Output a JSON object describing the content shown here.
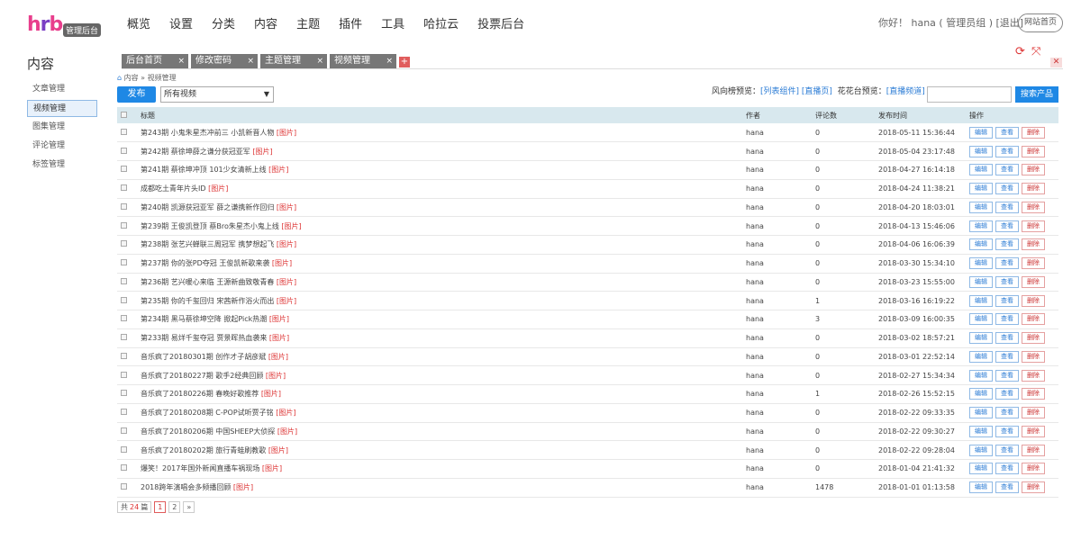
{
  "header": {
    "logo": "hrb",
    "logo_badge": "管理后台",
    "nav": [
      "概览",
      "设置",
      "分类",
      "内容",
      "主题",
      "插件",
      "工具",
      "哈拉云",
      "投票后台"
    ],
    "greeting": "你好！ hana ( 管理员组 ) [退出]",
    "site_home": "网站首页"
  },
  "sidebar": {
    "title": "内容",
    "items": [
      "文章管理",
      "视频管理",
      "图集管理",
      "评论管理",
      "标签管理"
    ],
    "active": "视频管理"
  },
  "tabs": [
    "后台首页",
    "修改密码",
    "主题管理",
    "视频管理"
  ],
  "breadcrumb": "内容 » 视频管理",
  "toolbar": {
    "publish": "发布",
    "filter_value": "所有视频",
    "preview_a_label": "风向榜预览：",
    "preview_a_links": [
      "[列表组件]",
      "[直播页]"
    ],
    "preview_b_label": "花花台预览：",
    "preview_b_links": [
      "[直播频道]"
    ],
    "search_btn": "搜索产品"
  },
  "table": {
    "headers": [
      "标题",
      "作者",
      "评论数",
      "发布时间",
      "操作"
    ],
    "img_tag": "[图片]",
    "ops": [
      "编辑",
      "查看",
      "删除"
    ],
    "rows": [
      {
        "title": "第243期 小鬼朱星杰冲前三 小凯新晋人物",
        "author": "hana",
        "comments": "0",
        "time": "2018-05-11 15:36:44"
      },
      {
        "title": "第242期 蔡徐坤薛之谦分获冠亚军",
        "author": "hana",
        "comments": "0",
        "time": "2018-05-04 23:17:48"
      },
      {
        "title": "第241期 蔡徐坤冲顶 101少女清新上线",
        "author": "hana",
        "comments": "0",
        "time": "2018-04-27 16:14:18"
      },
      {
        "title": "成都吃土青年片头ID",
        "author": "hana",
        "comments": "0",
        "time": "2018-04-24 11:38:21"
      },
      {
        "title": "第240期 凯源获冠亚军 薛之谦携新作回归",
        "author": "hana",
        "comments": "0",
        "time": "2018-04-20 18:03:01"
      },
      {
        "title": "第239期 王俊凯登顶 蔡Bro朱星杰小鬼上线",
        "author": "hana",
        "comments": "0",
        "time": "2018-04-13 15:46:06"
      },
      {
        "title": "第238期 张艺兴蝉联三周冠军 携梦想起飞",
        "author": "hana",
        "comments": "0",
        "time": "2018-04-06 16:06:39"
      },
      {
        "title": "第237期 你的张PD夺冠 王俊凯新歌来袭",
        "author": "hana",
        "comments": "0",
        "time": "2018-03-30 15:34:10"
      },
      {
        "title": "第236期 艺兴暖心来临 王源新曲致敬青春",
        "author": "hana",
        "comments": "0",
        "time": "2018-03-23 15:55:00"
      },
      {
        "title": "第235期 你的千玺回归 宋茜新作浴火而出",
        "author": "hana",
        "comments": "1",
        "time": "2018-03-16 16:19:22"
      },
      {
        "title": "第234期 黑马蔡徐坤空降 掀起Pick热潮",
        "author": "hana",
        "comments": "3",
        "time": "2018-03-09 16:00:35"
      },
      {
        "title": "第233期 易烊千玺夺冠 贾景晖热血袭来",
        "author": "hana",
        "comments": "0",
        "time": "2018-03-02 18:57:21"
      },
      {
        "title": "音乐疯了20180301期 创作才子胡彦斌",
        "author": "hana",
        "comments": "0",
        "time": "2018-03-01 22:52:14"
      },
      {
        "title": "音乐疯了20180227期 歌手2经典回顾",
        "author": "hana",
        "comments": "0",
        "time": "2018-02-27 15:34:34"
      },
      {
        "title": "音乐疯了20180226期 春晚好歌推荐",
        "author": "hana",
        "comments": "1",
        "time": "2018-02-26 15:52:15"
      },
      {
        "title": "音乐疯了20180208期 C-POP试听贾子铭",
        "author": "hana",
        "comments": "0",
        "time": "2018-02-22 09:33:35"
      },
      {
        "title": "音乐疯了20180206期 中国SHEEP大侦探",
        "author": "hana",
        "comments": "0",
        "time": "2018-02-22 09:30:27"
      },
      {
        "title": "音乐疯了20180202期 旅行青蛙刷教歌",
        "author": "hana",
        "comments": "0",
        "time": "2018-02-22 09:28:04"
      },
      {
        "title": "爆笑！2017年国外新闻直播车祸现场",
        "author": "hana",
        "comments": "0",
        "time": "2018-01-04 21:41:32"
      },
      {
        "title": "2018跨年演唱会多频播回顾",
        "author": "hana",
        "comments": "1478",
        "time": "2018-01-01 01:13:58"
      }
    ]
  },
  "pager": {
    "prefix": "共",
    "count": "24",
    "suffix": "篇",
    "pages": [
      "1",
      "2",
      "»"
    ],
    "current": "1"
  },
  "colors": {
    "accent": "#1e88e5",
    "header_row": "#d8e8ee",
    "danger": "#dd3333"
  }
}
